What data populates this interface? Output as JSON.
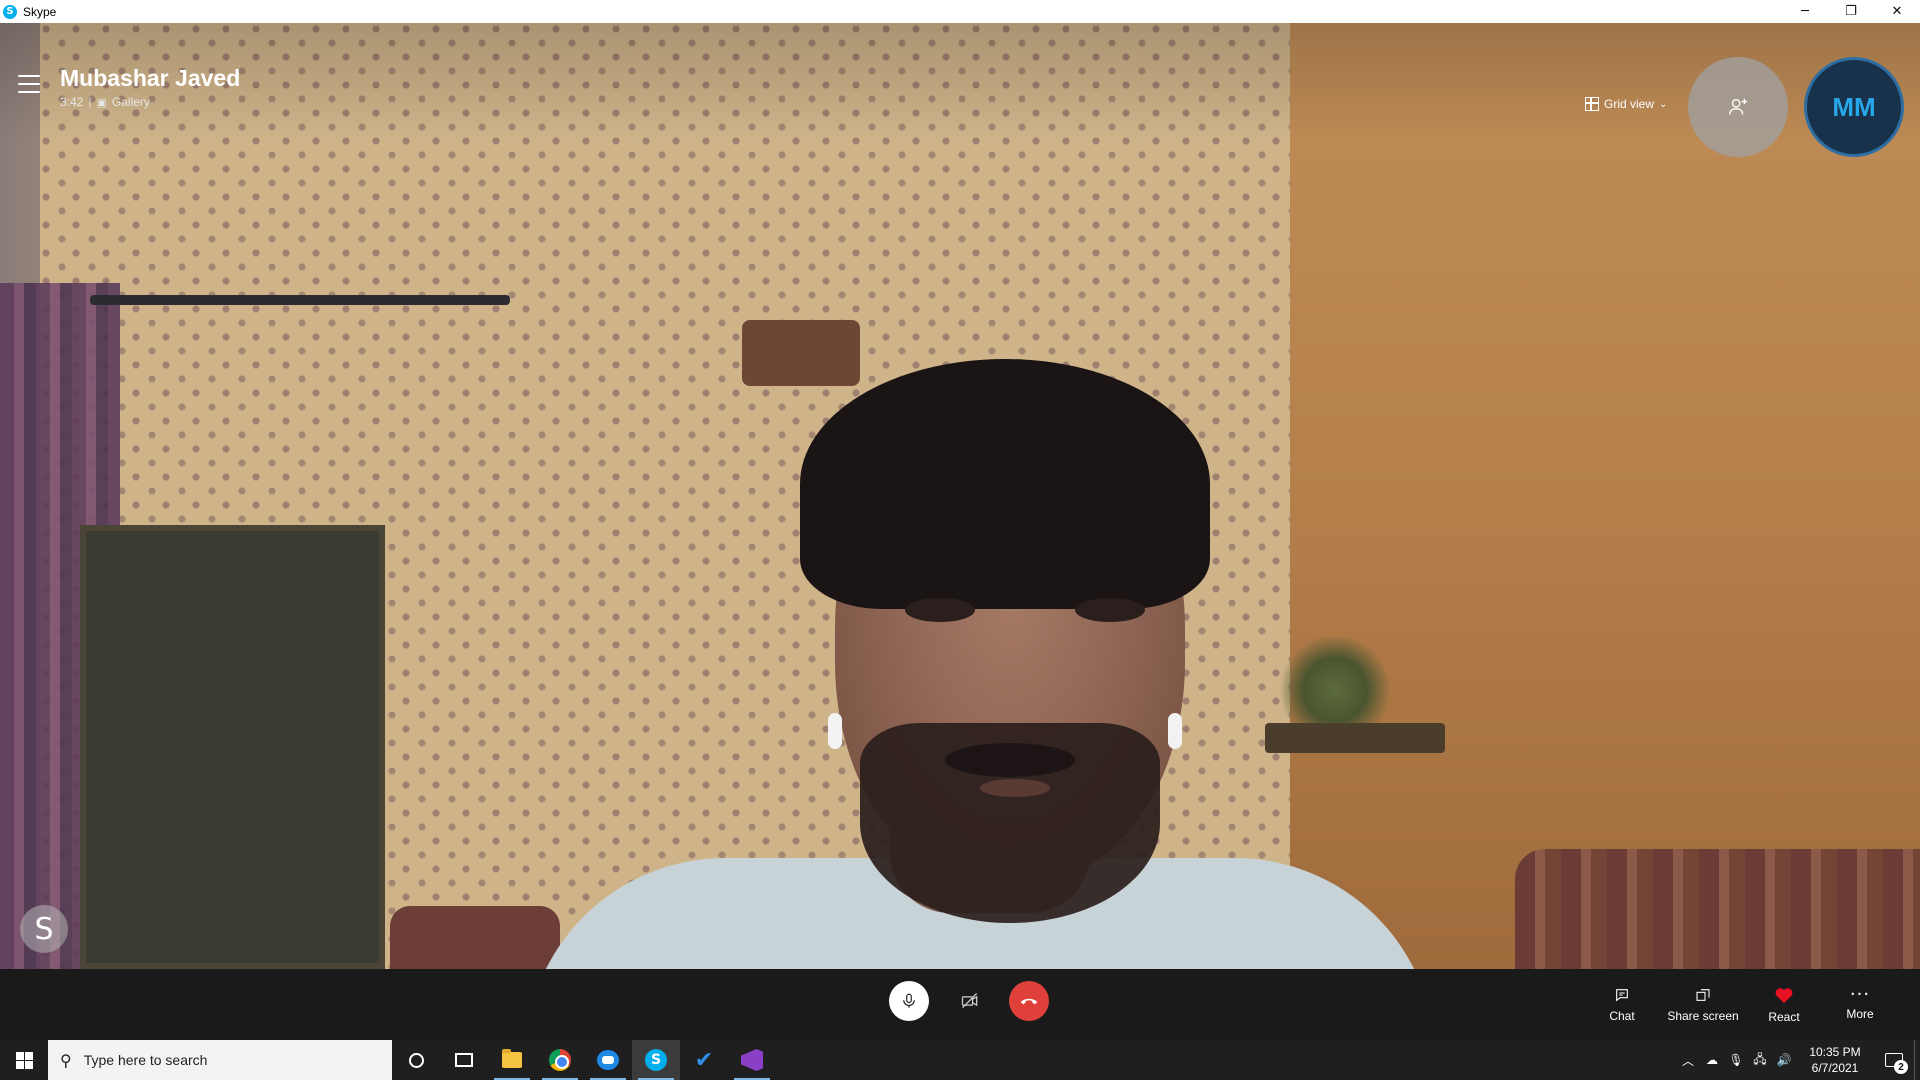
{
  "window": {
    "title": "Skype",
    "icon": "skype-logo-icon",
    "controls": {
      "minimize": "─",
      "restore": "❐",
      "close": "✕"
    }
  },
  "call": {
    "contact_name": "Mubashar Javed",
    "duration": "3:42",
    "separator": "|",
    "layout_label": "Gallery",
    "view_mode": "Grid view",
    "self_initials": "MM",
    "skype_badge": "S"
  },
  "controls": {
    "chat_label": "Chat",
    "share_label": "Share screen",
    "react_label": "React",
    "more_label": "More"
  },
  "taskbar": {
    "search_placeholder": "Type here to search",
    "clock_time": "10:35 PM",
    "clock_date": "6/7/2021",
    "notification_count": "2",
    "apps": [
      "cortana-icon",
      "task-view-icon",
      "file-explorer-icon",
      "chrome-icon",
      "mail-icon",
      "skype-icon",
      "todo-icon",
      "visual-studio-icon"
    ]
  },
  "colors": {
    "accent": "#00aff0",
    "hangup": "#e0403a",
    "react_heart": "#e81123",
    "self_avatar_bg": "#17324a",
    "self_avatar_text": "#28a8ea",
    "control_bar": "#1a1a1a",
    "taskbar": "#1f1f1f"
  }
}
